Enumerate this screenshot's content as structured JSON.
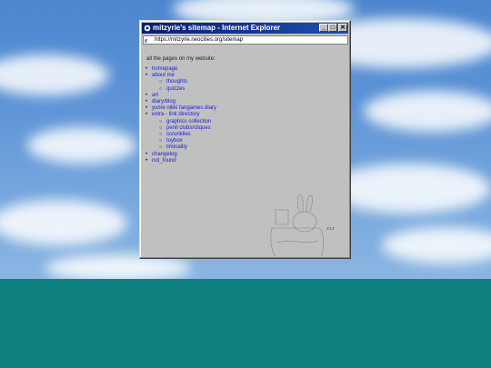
{
  "window": {
    "title": "mitzyrie's sitemap - Internet Explorer",
    "address": "https://mitzyrie.neocities.org/sitemap",
    "buttons": {
      "minimize": "_",
      "maximize": "□",
      "close": "✕"
    }
  },
  "page": {
    "intro": "all the pages on my website:",
    "items": [
      {
        "label": "homepage",
        "children": []
      },
      {
        "label": "about me",
        "children": [
          "thoughts",
          "quizzes"
        ]
      },
      {
        "label": "art",
        "children": []
      },
      {
        "label": "diary/blog",
        "children": []
      },
      {
        "label": "yume nikki fangames diary",
        "children": []
      },
      {
        "label": "extra - link directory",
        "children": [
          "graphics collection",
          "penil clubs/cliques",
          "scrunklies",
          "toybox",
          "liminality"
        ]
      },
      {
        "label": "changelog",
        "children": []
      },
      {
        "label": "not_found",
        "children": []
      }
    ]
  },
  "icons": [
    "ie-icon",
    "page-e-icon"
  ],
  "colors": {
    "titlebar": "#0a1e72",
    "link": "#1a1ad6",
    "window": "#c0c0c0",
    "ground": "#0e8080"
  }
}
